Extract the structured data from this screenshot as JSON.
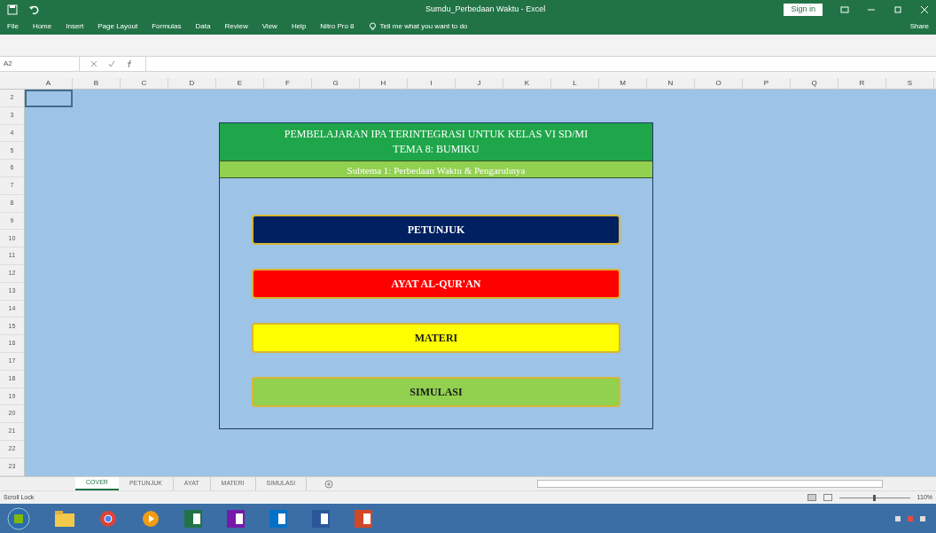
{
  "window": {
    "title": "Sumdu_Perbedaan Waktu - Excel",
    "sign_in": "Sign in"
  },
  "ribbon_tabs": [
    "File",
    "Home",
    "Insert",
    "Page Layout",
    "Formulas",
    "Data",
    "Review",
    "View",
    "Help",
    "Nitro Pro 8"
  ],
  "tell_me": "Tell me what you want to do",
  "share": "Share",
  "name_box": "A2",
  "columns": [
    "A",
    "B",
    "C",
    "D",
    "E",
    "F",
    "G",
    "H",
    "I",
    "J",
    "K",
    "L",
    "M",
    "N",
    "O",
    "P",
    "Q",
    "R",
    "S"
  ],
  "rows": [
    "2",
    "3",
    "4",
    "5",
    "6",
    "7",
    "8",
    "9",
    "10",
    "11",
    "12",
    "13",
    "14",
    "15",
    "16",
    "17",
    "18",
    "19",
    "20",
    "21",
    "22",
    "23"
  ],
  "cover": {
    "title": "PEMBELAJARAN IPA TERINTEGRASI UNTUK KELAS VI SD/MI",
    "theme": "TEMA 8: BUMIKU",
    "subtitle": "Subtema 1: Perbedaan Waktu & Pengaruhnya",
    "buttons": [
      {
        "label": "PETUNJUK",
        "color": "#002060"
      },
      {
        "label": "AYAT AL-QUR'AN",
        "color": "#ff0000"
      },
      {
        "label": "MATERI",
        "color": "#ffff00"
      },
      {
        "label": "SIMULASI",
        "color": "#92d050"
      }
    ]
  },
  "sheets": [
    {
      "label": "COVER",
      "selected": true
    },
    {
      "label": "PETUNJUK",
      "selected": false
    },
    {
      "label": "AYAT",
      "selected": false
    },
    {
      "label": "MATERI",
      "selected": false
    },
    {
      "label": "SIMULASI",
      "selected": false
    }
  ],
  "status": "Scroll Lock",
  "zoom": "110%",
  "zoom_slider": {
    "level": 0.5
  }
}
